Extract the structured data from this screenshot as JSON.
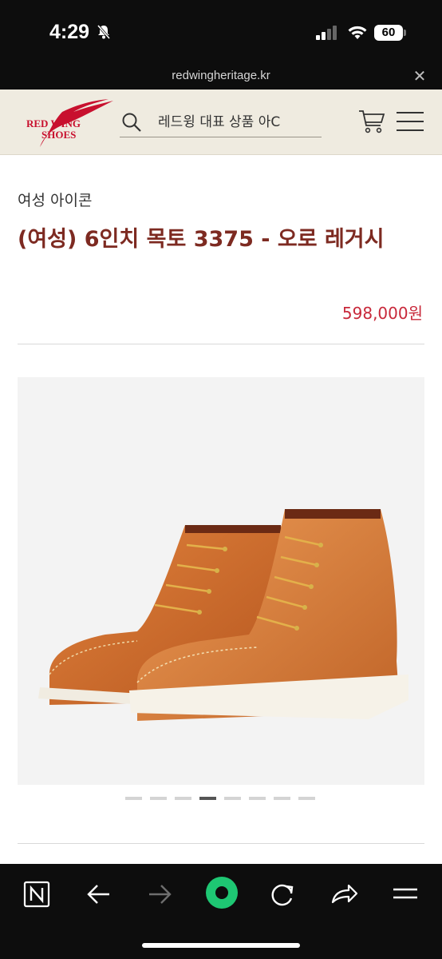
{
  "status_bar": {
    "time": "4:29",
    "battery": "60"
  },
  "url_bar": {
    "url": "redwingheritage.kr"
  },
  "header": {
    "logo_text_line1": "RED WING",
    "logo_text_line2": "SHOES",
    "search_placeholder": "레드윙 대표 상품 아C"
  },
  "product": {
    "category": "여성 아이콘",
    "title": "(여성) 6인치 목토 3375 - 오로 레거시",
    "price": "598,000원"
  },
  "carousel": {
    "total": 8,
    "active_index": 3
  },
  "colors": {
    "header_bg": "#efebe0",
    "title": "#7d2a21",
    "price": "#c8283a",
    "logo_red": "#c8102e",
    "toolbar_accent": "#1ec773"
  }
}
